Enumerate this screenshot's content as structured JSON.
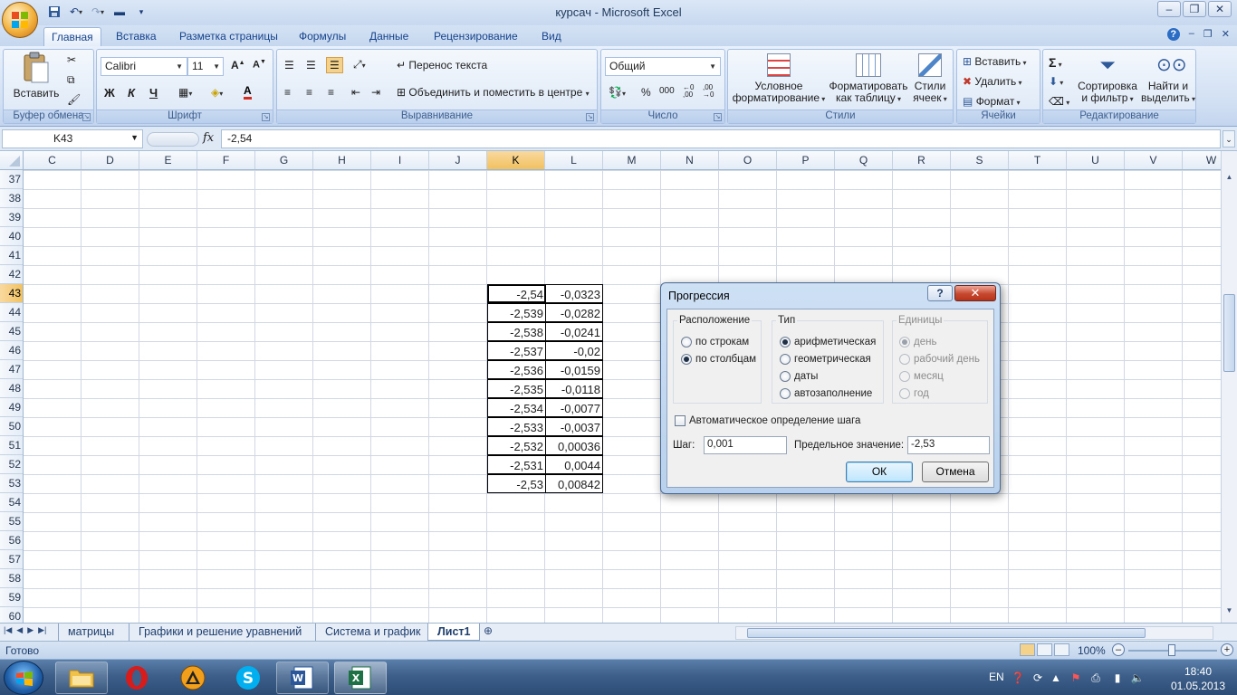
{
  "window": {
    "title": "курсач - Microsoft Excel"
  },
  "ribbon_tabs": [
    "Главная",
    "Вставка",
    "Разметка страницы",
    "Формулы",
    "Данные",
    "Рецензирование",
    "Вид"
  ],
  "ribbon": {
    "clipboard": {
      "paste": "Вставить",
      "label": "Буфер обмена"
    },
    "font": {
      "name": "Calibri",
      "size": "11",
      "bold": "Ж",
      "italic": "К",
      "underline": "Ч",
      "label": "Шрифт"
    },
    "alignment": {
      "wrap": "Перенос текста",
      "merge": "Объединить и поместить в центре",
      "label": "Выравнивание"
    },
    "number": {
      "format": "Общий",
      "percent": "%",
      "thousands": "000",
      "label": "Число"
    },
    "styles": {
      "conditional": "Условное форматирование",
      "conditional_l1": "Условное",
      "conditional_l2": "форматирование",
      "table_l1": "Форматировать",
      "table_l2": "как таблицу",
      "cell_l1": "Стили",
      "cell_l2": "ячеек",
      "label": "Стили"
    },
    "cells": {
      "insert": "Вставить",
      "delete": "Удалить",
      "format": "Формат",
      "label": "Ячейки"
    },
    "editing": {
      "sort_l1": "Сортировка",
      "sort_l2": "и фильтр",
      "find_l1": "Найти и",
      "find_l2": "выделить",
      "label": "Редактирование"
    }
  },
  "formula_bar": {
    "name_box": "K43",
    "fx": "fx",
    "formula": "-2,54"
  },
  "grid": {
    "columns": [
      "C",
      "D",
      "E",
      "F",
      "G",
      "H",
      "I",
      "J",
      "K",
      "L",
      "M",
      "N",
      "O",
      "P",
      "Q",
      "R",
      "S",
      "T",
      "U",
      "V",
      "W"
    ],
    "selected_column": "K",
    "rows": [
      "37",
      "38",
      "39",
      "40",
      "41",
      "42",
      "43",
      "44",
      "45",
      "46",
      "47",
      "48",
      "49",
      "50",
      "51",
      "52",
      "53",
      "54",
      "55",
      "56",
      "57",
      "58",
      "59",
      "60"
    ],
    "selected_row": "43",
    "k_values": [
      "-2,54",
      "-2,539",
      "-2,538",
      "-2,537",
      "-2,536",
      "-2,535",
      "-2,534",
      "-2,533",
      "-2,532",
      "-2,531",
      "-2,53"
    ],
    "l_values": [
      "-0,0323",
      "-0,0282",
      "-0,0241",
      "-0,02",
      "-0,0159",
      "-0,0118",
      "-0,0077",
      "-0,0037",
      "0,00036",
      "0,0044",
      "0,00842"
    ]
  },
  "sheets": [
    "матрицы",
    "Графики и решение уравнений",
    "Система и график",
    "Лист1"
  ],
  "active_sheet": "Лист1",
  "status": {
    "ready": "Готово",
    "zoom": "100%"
  },
  "dialog": {
    "title": "Прогрессия",
    "help": "?",
    "close": "✕",
    "location": {
      "legend": "Расположение",
      "rows": "по строкам",
      "columns": "по столбцам"
    },
    "type": {
      "legend": "Тип",
      "arithmetic": "арифметическая",
      "geometric": "геометрическая",
      "dates": "даты",
      "autofill": "автозаполнение"
    },
    "units": {
      "legend": "Единицы",
      "day": "день",
      "workday": "рабочий день",
      "month": "месяц",
      "year": "год"
    },
    "auto_step": "Автоматическое определение шага",
    "step_label": "Шаг:",
    "step_value": "0,001",
    "limit_label": "Предельное значение:",
    "limit_value": "-2,53",
    "ok": "ОК",
    "cancel": "Отмена"
  },
  "taskbar": {
    "lang": "EN",
    "time": "18:40",
    "date": "01.05.2013"
  },
  "colors": {
    "selection_header": "#f1c15f",
    "ribbon_text": "#15428b",
    "dialog_close": "#c6482f"
  }
}
